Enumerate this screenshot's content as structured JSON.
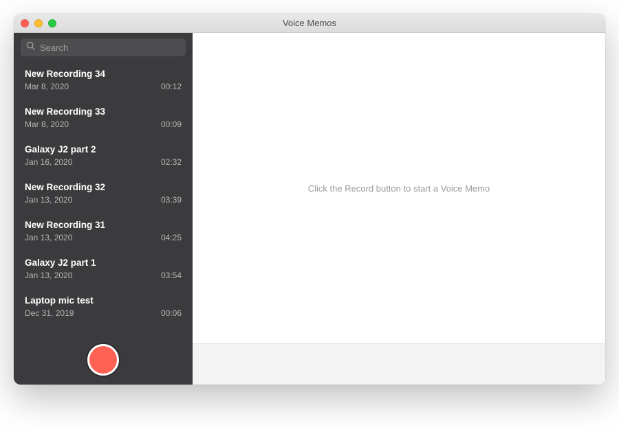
{
  "window": {
    "title": "Voice Memos"
  },
  "sidebar": {
    "search_placeholder": "Search",
    "recordings": [
      {
        "title": "New Recording 34",
        "date": "Mar 8, 2020",
        "duration": "00:12"
      },
      {
        "title": "New Recording 33",
        "date": "Mar 8, 2020",
        "duration": "00:09"
      },
      {
        "title": "Galaxy J2 part 2",
        "date": "Jan 16, 2020",
        "duration": "02:32"
      },
      {
        "title": "New Recording 32",
        "date": "Jan 13, 2020",
        "duration": "03:39"
      },
      {
        "title": "New Recording 31",
        "date": "Jan 13, 2020",
        "duration": "04:25"
      },
      {
        "title": "Galaxy J2 part 1",
        "date": "Jan 13, 2020",
        "duration": "03:54"
      },
      {
        "title": "Laptop mic test",
        "date": "Dec 31, 2019",
        "duration": "00:06"
      }
    ]
  },
  "content": {
    "empty_hint": "Click the Record button to start a Voice Memo"
  }
}
